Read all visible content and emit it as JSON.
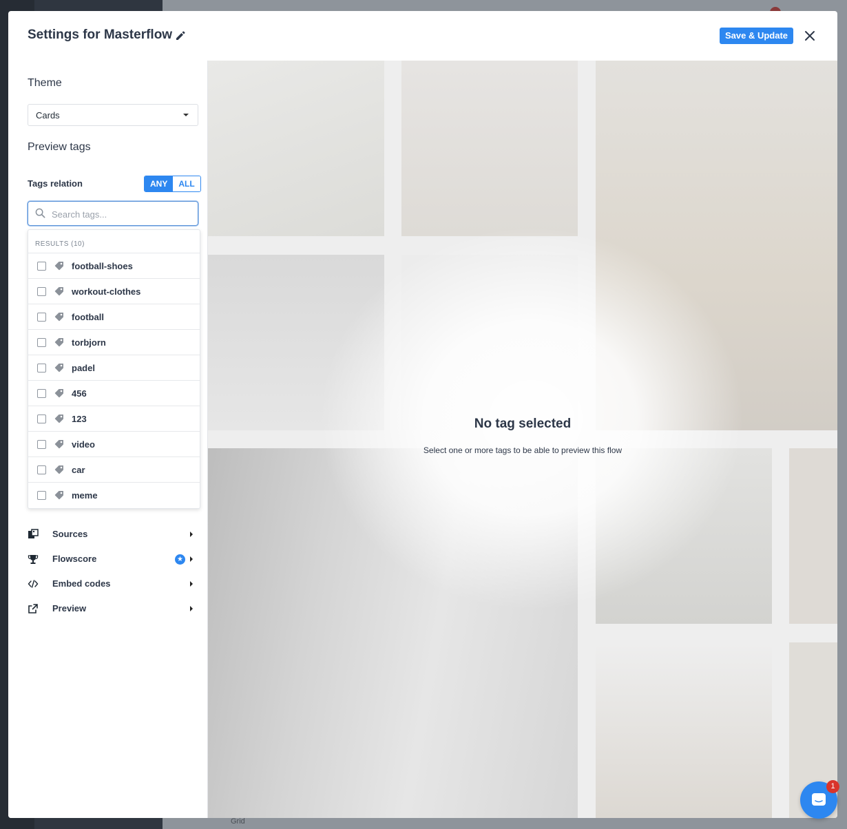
{
  "background": {
    "grid_label": "Grid"
  },
  "header": {
    "title": "Settings for Masterflow",
    "save_label": "Save & Update"
  },
  "theme": {
    "heading": "Theme",
    "selected": "Cards"
  },
  "preview_tags": {
    "heading": "Preview tags",
    "relation_label": "Tags relation",
    "relation_options": [
      "ANY",
      "ALL"
    ],
    "relation_selected": "ANY",
    "search_placeholder": "Search tags...",
    "results_header": "RESULTS (10)",
    "tags": [
      {
        "label": "football-shoes",
        "checked": false
      },
      {
        "label": "workout-clothes",
        "checked": false
      },
      {
        "label": "football",
        "checked": false
      },
      {
        "label": "torbjorn",
        "checked": false
      },
      {
        "label": "padel",
        "checked": false
      },
      {
        "label": "456",
        "checked": false
      },
      {
        "label": "123",
        "checked": false
      },
      {
        "label": "video",
        "checked": false
      },
      {
        "label": "car",
        "checked": false
      },
      {
        "label": "meme",
        "checked": false
      }
    ]
  },
  "menu": [
    {
      "label": "Sources",
      "icon": "sources-icon"
    },
    {
      "label": "Flowscore",
      "icon": "trophy-icon",
      "badge": "★"
    },
    {
      "label": "Embed codes",
      "icon": "code-icon"
    },
    {
      "label": "Preview",
      "icon": "external-link-icon"
    }
  ],
  "preview": {
    "empty_title": "No tag selected",
    "empty_subtitle": "Select one or more tags to be able to preview this flow"
  },
  "chat": {
    "unread_count": "1"
  },
  "colors": {
    "accent": "#2d87f0",
    "notification": "#d9342b"
  }
}
